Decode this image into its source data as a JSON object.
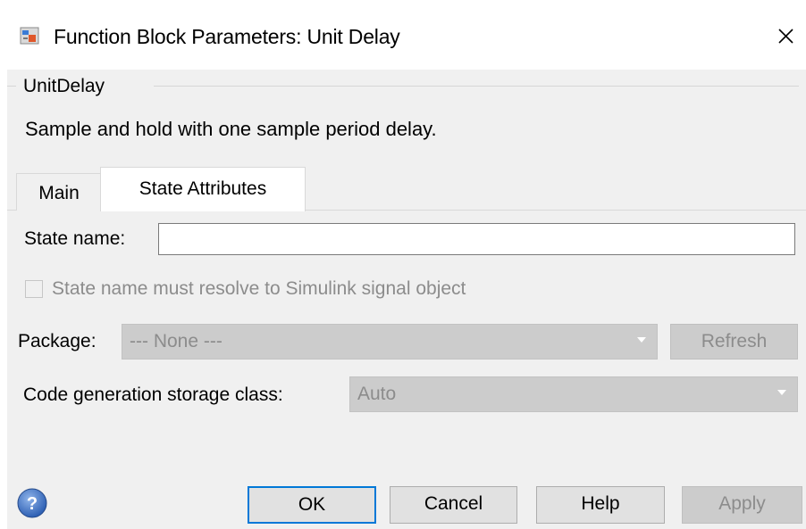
{
  "window": {
    "title": "Function Block Parameters: Unit Delay",
    "close_glyph": "✕",
    "icon": "simulink-block-icon"
  },
  "block": {
    "group_label": "UnitDelay",
    "description": "Sample and hold with one sample period delay."
  },
  "tabs": [
    {
      "label": "Main",
      "selected": false
    },
    {
      "label": "State Attributes",
      "selected": true
    }
  ],
  "state_attributes": {
    "state_name_label": "State name:",
    "state_name_value": "",
    "resolve_checkbox_label": "State name must resolve to Simulink signal object",
    "resolve_checked": false,
    "package_label": "Package:",
    "package_value": "--- None ---",
    "refresh_label": "Refresh",
    "storage_class_label": "Code generation storage class:",
    "storage_class_value": "Auto"
  },
  "buttons": {
    "ok": "OK",
    "cancel": "Cancel",
    "help": "Help",
    "apply": "Apply"
  },
  "colors": {
    "focus_border": "#0078d7",
    "panel_background": "#f0f0f0",
    "disabled_fill": "#cccccc"
  }
}
